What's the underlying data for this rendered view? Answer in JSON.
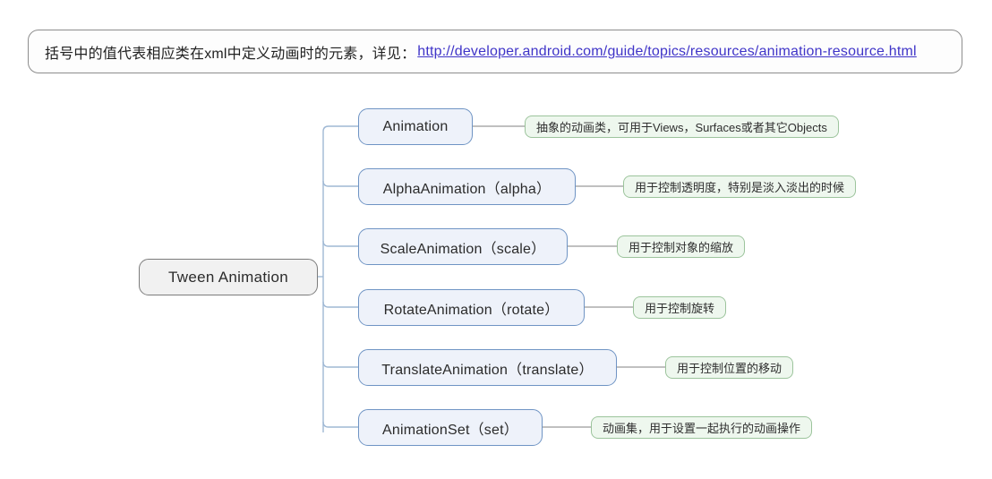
{
  "header": {
    "text_prefix": "括号中的值代表相应类在xml中定义动画时的元素，详见：",
    "url": "http://developer.android.com/guide/topics/resources/animation-resource.html",
    "url_color": "#3f34c8",
    "border_color": "#8d8d8d"
  },
  "diagram": {
    "type": "mindmap",
    "root": {
      "label": "Tween Animation",
      "fill": "#f1f1f1",
      "border": "#7c7c7c"
    },
    "node_style": {
      "fill": "#eef2fa",
      "border": "#6f94c4"
    },
    "note_style": {
      "fill": "#eef7ee",
      "border": "#9cc49c"
    },
    "connector_color": "#9fb8d4",
    "note_connector_color": "#9a9a9a",
    "branches": [
      {
        "label": "Animation",
        "note": "抽象的动画类，可用于Views，Surfaces或者其它Objects"
      },
      {
        "label": "AlphaAnimation（alpha）",
        "note": "用于控制透明度，特别是淡入淡出的时候"
      },
      {
        "label": "ScaleAnimation（scale）",
        "note": "用于控制对象的缩放"
      },
      {
        "label": "RotateAnimation（rotate）",
        "note": "用于控制旋转"
      },
      {
        "label": "TranslateAnimation（translate）",
        "note": "用于控制位置的移动"
      },
      {
        "label": "AnimationSet（set）",
        "note": "动画集，用于设置一起执行的动画操作"
      }
    ]
  }
}
